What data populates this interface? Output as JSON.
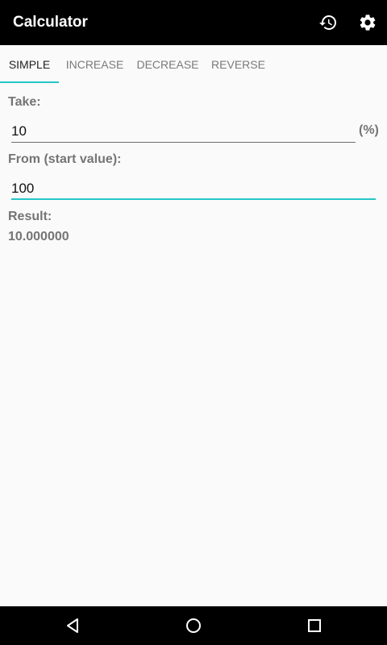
{
  "app_bar": {
    "title": "Calculator",
    "icons": [
      "history-icon",
      "settings-icon"
    ]
  },
  "tabs": [
    {
      "label": "SIMPLE",
      "active": true
    },
    {
      "label": "INCREASE",
      "active": false
    },
    {
      "label": "DECREASE",
      "active": false
    },
    {
      "label": "REVERSE",
      "active": false
    }
  ],
  "form": {
    "take_label": "Take:",
    "take_value": "10",
    "take_unit": "(%)",
    "from_label": "From (start value):",
    "from_value": "100",
    "result_label": "Result:",
    "result_value": "10.000000"
  },
  "colors": {
    "accent": "#26c6c6",
    "app_bar": "#000000",
    "label": "#757575"
  },
  "nav_bar": {
    "icons": [
      "back-icon",
      "home-icon",
      "recents-icon"
    ]
  }
}
